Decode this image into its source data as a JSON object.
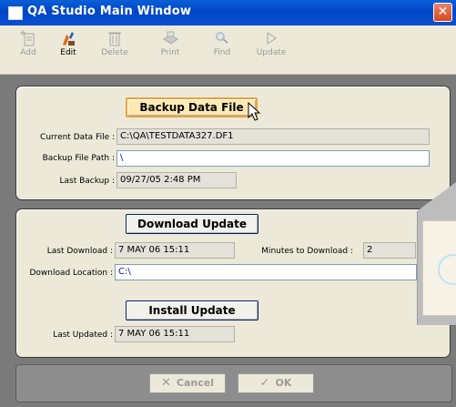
{
  "window": {
    "title": "QA Studio Main Window",
    "close_glyph": "✕"
  },
  "toolbar": {
    "items": [
      {
        "label": "Add",
        "icon": "add-icon",
        "enabled": false
      },
      {
        "label": "Edit",
        "icon": "edit-icon",
        "enabled": true
      },
      {
        "label": "Delete",
        "icon": "delete-icon",
        "enabled": false
      },
      {
        "label": "Print",
        "icon": "print-icon",
        "enabled": false
      },
      {
        "label": "Find",
        "icon": "find-icon",
        "enabled": false
      },
      {
        "label": "Update",
        "icon": "update-icon",
        "enabled": false
      }
    ]
  },
  "backup": {
    "button_label": "Backup Data File",
    "current_data_file_label": "Current Data File :",
    "current_data_file_value": "C:\\QA\\TESTDATA327.DF1",
    "backup_file_path_label": "Backup File Path :",
    "backup_file_path_value": "\\",
    "last_backup_label": "Last Backup :",
    "last_backup_value": "09/27/05 2:48 PM"
  },
  "update": {
    "download_button_label": "Download Update",
    "last_download_label": "Last Download :",
    "last_download_value": "7 MAY 06  15:11",
    "minutes_label": "Minutes to Download :",
    "minutes_value": "2",
    "download_location_label": "Download Location :",
    "download_location_value": "C:\\",
    "install_button_label": "Install Update",
    "last_updated_label": "Last Updated :",
    "last_updated_value": "7 MAY 06  15:11"
  },
  "footer": {
    "cancel_label": "Cancel",
    "ok_label": "OK"
  },
  "colors": {
    "title_bar": "#0a5fd8",
    "focused_button": "#ffe9b3",
    "edit_text": "#001a9a"
  }
}
